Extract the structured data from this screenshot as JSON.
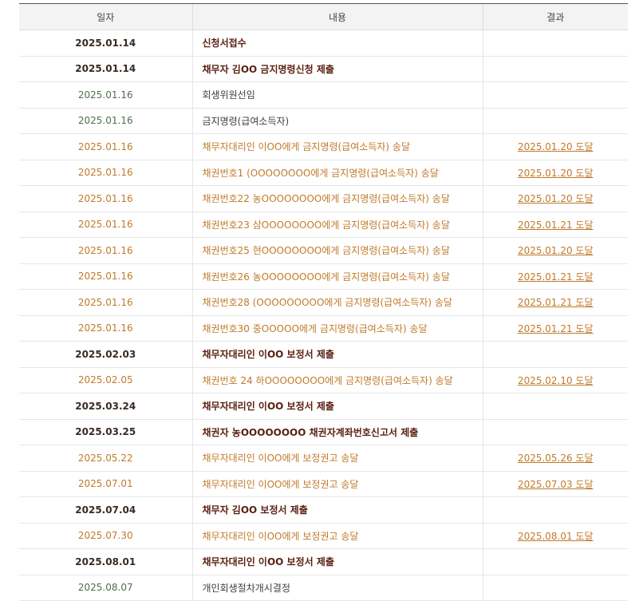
{
  "table": {
    "headers": {
      "date": "일자",
      "content": "내용",
      "result": "결과"
    },
    "rows": [
      {
        "date": "2025.01.14",
        "content": "신청서접수",
        "result": "",
        "type": "submit"
      },
      {
        "date": "2025.01.14",
        "content": "채무자 김OO 금지명령신청 제출",
        "result": "",
        "type": "submit"
      },
      {
        "date": "2025.01.16",
        "content": "회생위원선임",
        "result": "",
        "type": "decision"
      },
      {
        "date": "2025.01.16",
        "content": "금지명령(급여소득자)",
        "result": "",
        "type": "decision"
      },
      {
        "date": "2025.01.16",
        "content": "채무자대리인 이OO에게 금지명령(급여소득자) 송달",
        "result": "2025.01.20 도달",
        "type": "delivery"
      },
      {
        "date": "2025.01.16",
        "content": "채권번호1 (OOOOOOOO에게 금지명령(급여소득자) 송달",
        "result": "2025.01.20 도달",
        "type": "delivery"
      },
      {
        "date": "2025.01.16",
        "content": "채권번호22 농OOOOOOOO에게 금지명령(급여소득자) 송달",
        "result": "2025.01.20 도달",
        "type": "delivery"
      },
      {
        "date": "2025.01.16",
        "content": "채권번호23 삼OOOOOOOO에게 금지명령(급여소득자) 송달",
        "result": "2025.01.21 도달",
        "type": "delivery"
      },
      {
        "date": "2025.01.16",
        "content": "채권번호25 현OOOOOOOO에게 금지명령(급여소득자) 송달",
        "result": "2025.01.20 도달",
        "type": "delivery"
      },
      {
        "date": "2025.01.16",
        "content": "채권번호26 농OOOOOOOO에게 금지명령(급여소득자) 송달",
        "result": "2025.01.21 도달",
        "type": "delivery"
      },
      {
        "date": "2025.01.16",
        "content": "채권번호28 (OOOOOOOOO에게 금지명령(급여소득자) 송달",
        "result": "2025.01.21 도달",
        "type": "delivery"
      },
      {
        "date": "2025.01.16",
        "content": "채권번호30 중OOOOO에게 금지명령(급여소득자) 송달",
        "result": "2025.01.21 도달",
        "type": "delivery"
      },
      {
        "date": "2025.02.03",
        "content": "채무자대리인 이OO 보정서 제출",
        "result": "",
        "type": "submit"
      },
      {
        "date": "2025.02.05",
        "content": "채권번호 24 하OOOOOOOO에게 금지명령(급여소득자) 송달",
        "result": "2025.02.10 도달",
        "type": "delivery"
      },
      {
        "date": "2025.03.24",
        "content": "채무자대리인 이OO 보정서 제출",
        "result": "",
        "type": "submit"
      },
      {
        "date": "2025.03.25",
        "content": "채권자 농OOOOOOOO 채권자계좌번호신고서 제출",
        "result": "",
        "type": "submit"
      },
      {
        "date": "2025.05.22",
        "content": "채무자대리인 이OO에게 보정권고 송달",
        "result": "2025.05.26 도달",
        "type": "delivery"
      },
      {
        "date": "2025.07.01",
        "content": "채무자대리인 이OO에게 보정권고 송달",
        "result": "2025.07.03 도달",
        "type": "delivery"
      },
      {
        "date": "2025.07.04",
        "content": "채무자 김OO 보정서 제출",
        "result": "",
        "type": "submit"
      },
      {
        "date": "2025.07.30",
        "content": "채무자대리인 이OO에게 보정권고 송달",
        "result": "2025.08.01 도달",
        "type": "delivery"
      },
      {
        "date": "2025.08.01",
        "content": "채무자대리인 이OO 보정서 제출",
        "result": "",
        "type": "submit"
      },
      {
        "date": "2025.08.07",
        "content": "개인회생절차개시결정",
        "result": "",
        "type": "decision"
      }
    ]
  },
  "colors": {
    "submit_date": "#3a2a24",
    "submit_content": "#5a1f10",
    "decision_date": "#4f6f4f",
    "decision_content": "#3e3e3e",
    "delivery": "#c07a2a",
    "header_bg": "#f3f3f3"
  }
}
